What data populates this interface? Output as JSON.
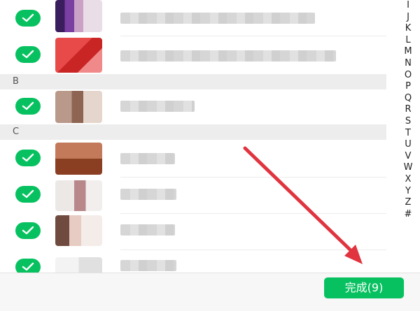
{
  "sections": [
    {
      "letter": "B"
    },
    {
      "letter": "C"
    }
  ],
  "index_letters": [
    "I",
    "J",
    "K",
    "L",
    "M",
    "N",
    "O",
    "P",
    "Q",
    "R",
    "S",
    "T",
    "U",
    "V",
    "W",
    "X",
    "Y",
    "Z",
    "#"
  ],
  "footer": {
    "done_label": "完成(9)"
  },
  "colors": {
    "accent": "#07c160",
    "annotation_arrow": "#e0343f"
  }
}
